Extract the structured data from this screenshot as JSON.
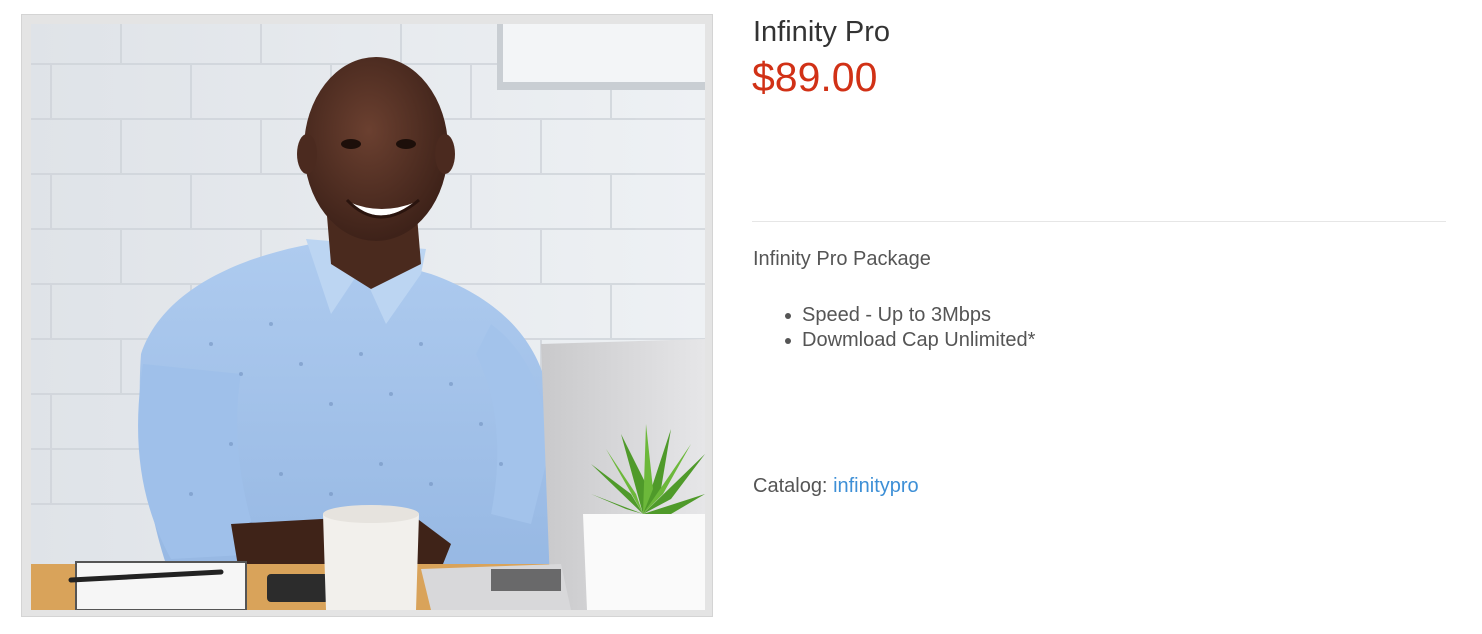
{
  "product": {
    "title": "Infinity Pro",
    "price": "$89.00",
    "image_alt": "Smiling man in blue shirt working at a laptop on a desk",
    "package_title": "Infinity Pro Package",
    "features": [
      "Speed - Up to 3Mbps",
      "Dowmload Cap Unlimited*"
    ],
    "catalog_label": "Catalog:",
    "catalog_link": "infinitypro"
  },
  "colors": {
    "price": "#d13116",
    "link": "#3d8fd6",
    "title": "#333333",
    "body_text": "#555555"
  }
}
